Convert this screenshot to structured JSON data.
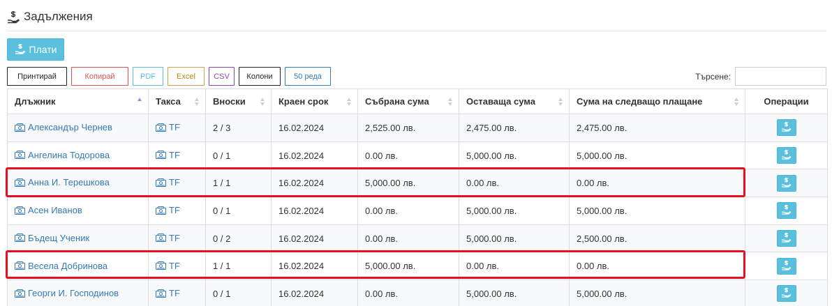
{
  "page": {
    "title": "Задължения",
    "title_icon": "hand-money-icon"
  },
  "actions": {
    "pay_label": "Плати",
    "pay_icon": "hand-money-icon"
  },
  "toolbar": {
    "print": "Принтирай",
    "copy": "Копирай",
    "pdf": "PDF",
    "excel": "Excel",
    "csv": "CSV",
    "columns": "Колони",
    "rows": "50 реда"
  },
  "search": {
    "label": "Търсене:",
    "value": "",
    "placeholder": ""
  },
  "table": {
    "columns": [
      {
        "label": "Длъжник",
        "sort": "asc"
      },
      {
        "label": "Такса",
        "sort": "both"
      },
      {
        "label": "Вноски",
        "sort": "both"
      },
      {
        "label": "Краен срок",
        "sort": "both"
      },
      {
        "label": "Събрана сума",
        "sort": "both"
      },
      {
        "label": "Оставаща сума",
        "sort": "both"
      },
      {
        "label": "Сума на следващо плащане",
        "sort": "both"
      },
      {
        "label": "Операции",
        "sort": "none"
      }
    ],
    "rows": [
      {
        "debtor": "Александър Чернев",
        "fee": "TF",
        "installments": "2 / 3",
        "due": "16.02.2024",
        "collected": "2,525.00 лв.",
        "remaining": "2,475.00 лв.",
        "next": "2,475.00 лв.",
        "highlighted": false
      },
      {
        "debtor": "Ангелина Тодорова",
        "fee": "TF",
        "installments": "0 / 1",
        "due": "16.02.2024",
        "collected": "0.00 лв.",
        "remaining": "5,000.00 лв.",
        "next": "5,000.00 лв.",
        "highlighted": false
      },
      {
        "debtor": "Анна И. Терешкова",
        "fee": "TF",
        "installments": "1 / 1",
        "due": "16.02.2024",
        "collected": "5,000.00 лв.",
        "remaining": "0.00 лв.",
        "next": "0.00 лв.",
        "highlighted": true
      },
      {
        "debtor": "Асен Иванов",
        "fee": "TF",
        "installments": "0 / 1",
        "due": "16.02.2024",
        "collected": "0.00 лв.",
        "remaining": "5,000.00 лв.",
        "next": "5,000.00 лв.",
        "highlighted": false
      },
      {
        "debtor": "Бъдещ Ученик",
        "fee": "TF",
        "installments": "0 / 2",
        "due": "16.02.2024",
        "collected": "0.00 лв.",
        "remaining": "5,000.00 лв.",
        "next": "2,500.00 лв.",
        "highlighted": false
      },
      {
        "debtor": "Весела Добринова",
        "fee": "TF",
        "installments": "1 / 1",
        "due": "16.02.2024",
        "collected": "5,000.00 лв.",
        "remaining": "0.00 лв.",
        "next": "0.00 лв.",
        "highlighted": true
      },
      {
        "debtor": "Георги И. Господинов",
        "fee": "TF",
        "installments": "0 / 1",
        "due": "16.02.2024",
        "collected": "0.00 лв.",
        "remaining": "5,000.00 лв.",
        "next": "5,000.00 лв.",
        "highlighted": false
      }
    ]
  },
  "colors": {
    "accent": "#5bc0de",
    "link": "#337ab7",
    "highlight": "#e8101e"
  }
}
